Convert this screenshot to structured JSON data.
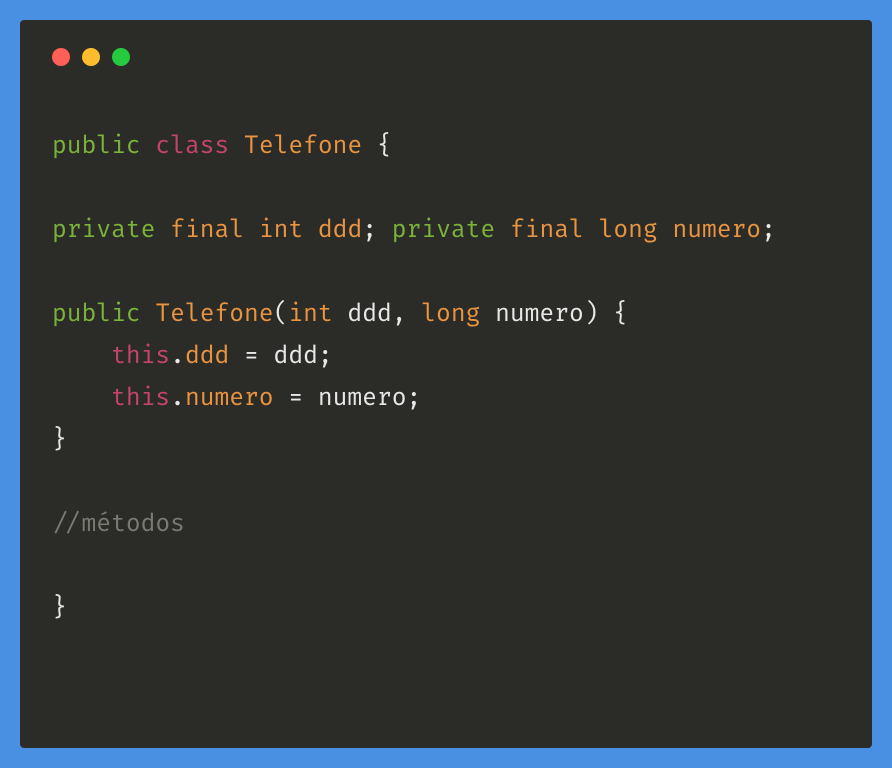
{
  "window": {
    "controls": {
      "red": "close",
      "yellow": "minimize",
      "green": "maximize"
    }
  },
  "code": {
    "line1": {
      "access": "public",
      "class_kw": "class",
      "name": "Telefone",
      "brace": " {"
    },
    "line2": {
      "access1": "private",
      "final1": "final",
      "type1": "int",
      "id1": "ddd",
      "semi1": ";",
      "access2": "private",
      "final2": "final",
      "type2": "long",
      "id2": "numero",
      "semi2": ";"
    },
    "line3": {
      "access": "public",
      "ctor": "Telefone",
      "paren_open": "(",
      "ptype1": "int",
      "pname1": " ddd, ",
      "ptype2": "long",
      "pname2": " numero) {"
    },
    "line4": {
      "indent": "    ",
      "this_kw": "this",
      "dot": ".",
      "member": "ddd",
      "rest": " = ddd;"
    },
    "line5": {
      "indent": "    ",
      "this_kw": "this",
      "dot": ".",
      "member": "numero",
      "rest": " = numero;"
    },
    "line6": {
      "brace": "}"
    },
    "line7": {
      "comment": "//métodos"
    },
    "line8": {
      "brace": "}"
    }
  }
}
